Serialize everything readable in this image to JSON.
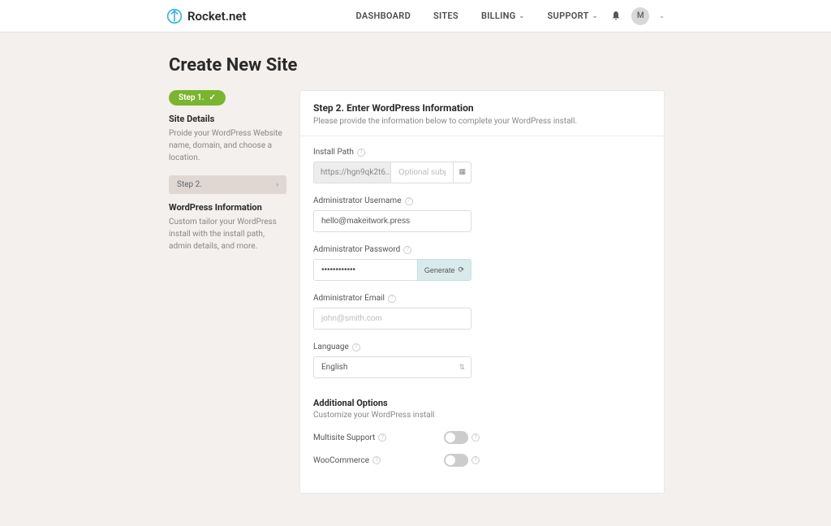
{
  "brand": "Rocket.net",
  "nav": {
    "dashboard": "DASHBOARD",
    "sites": "SITES",
    "billing": "BILLING",
    "support": "SUPPORT"
  },
  "avatar_initial": "M",
  "page_title": "Create New Site",
  "sidebar": {
    "step1_pill": "Step 1.",
    "step1_title": "Site Details",
    "step1_desc": "Proide your WordPress Website name, domain, and choose a location.",
    "step2_label": "Step 2.",
    "step2_title": "WordPress Information",
    "step2_desc": "Custom tailor your WordPress install with the install path, admin details, and more."
  },
  "panel": {
    "title": "Step 2. Enter WordPress Information",
    "subtitle": "Please provide the information below to complete your WordPress install."
  },
  "fields": {
    "install_path": {
      "label": "Install Path",
      "prefix": "https://hgn9qk2t6...",
      "placeholder": "Optional subpath"
    },
    "admin_user": {
      "label": "Administrator Username",
      "value": "hello@makeitwork.press"
    },
    "admin_pass": {
      "label": "Administrator Password",
      "value": "••••••••••••",
      "generate": "Generate"
    },
    "admin_email": {
      "label": "Administrator Email",
      "placeholder": "john@smith.com"
    },
    "language": {
      "label": "Language",
      "value": "English"
    }
  },
  "additional": {
    "title": "Additional Options",
    "subtitle": "Customize your WordPress install",
    "multisite": "Multisite Support",
    "woocommerce": "WooCommerce"
  }
}
